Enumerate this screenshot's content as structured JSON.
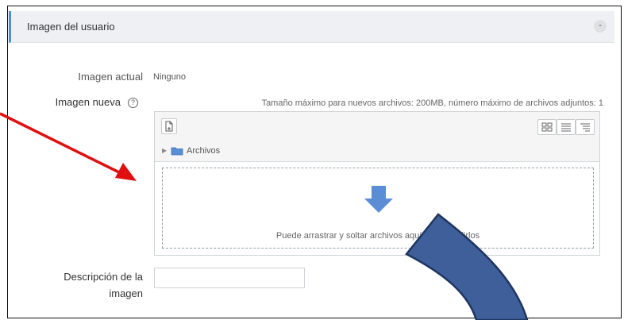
{
  "section": {
    "title": "Imagen del usuario",
    "collapse_symbol": "-"
  },
  "current_image": {
    "label": "Imagen actual",
    "value": "Ninguno"
  },
  "new_image": {
    "label": "Imagen nueva",
    "help_symbol": "?",
    "limits": "Tamaño máximo para nuevos archivos: 200MB, número máximo de archivos adjuntos: 1"
  },
  "file_manager": {
    "path_label": "Archivos",
    "dropzone_text": "Puede arrastrar y soltar archivos aquí para añadirlos",
    "icons": [
      "add-file-icon",
      "grid-view-icon",
      "list-view-icon",
      "tree-view-icon",
      "folder-icon",
      "upload-arrow-icon"
    ]
  },
  "description": {
    "label_line1": "Descripción de la",
    "label_line2": "imagen",
    "value": ""
  },
  "colors": {
    "accent": "#4a90d9",
    "red_arrow": "#e01010",
    "blue_arrow": "#3e5f9a",
    "dropzone_arrow": "#5b8dd6"
  }
}
